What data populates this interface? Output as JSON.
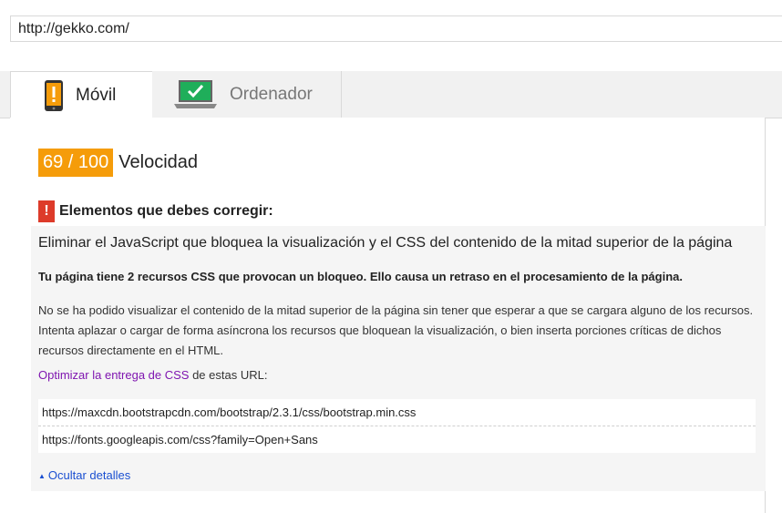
{
  "address_bar": {
    "value": "http://gekko.com/"
  },
  "tabs": [
    {
      "label": "Móvil",
      "icon": "phone-warning-icon",
      "active": true
    },
    {
      "label": "Ordenador",
      "icon": "laptop-check-icon",
      "active": false
    }
  ],
  "score": {
    "value": "69 / 100",
    "label": "Velocidad",
    "color": "#f59c0a"
  },
  "fix_section": {
    "title": "Elementos que debes corregir:",
    "icon_glyph": "!",
    "icon_color": "#dd3b2a"
  },
  "rule": {
    "title": "Eliminar el JavaScript que bloquea la visualización y el CSS del contenido de la mitad superior de la página",
    "summary": "Tu página tiene 2 recursos CSS que provocan un bloqueo. Ello causa un retraso en el procesamiento de la página.",
    "description": "No se ha podido visualizar el contenido de la mitad superior de la página sin tener que esperar a que se cargara alguno de los recursos. Intenta aplazar o cargar de forma asíncrona los recursos que bloquean la visualización, o bien inserta porciones críticas de dichos recursos directamente en el HTML.",
    "link_text": "Optimizar la entrega de CSS",
    "link_suffix": " de estas URL:",
    "urls": [
      "https://maxcdn.bootstrapcdn.com/bootstrap/2.3.1/css/bootstrap.min.css",
      "https://fonts.googleapis.com/css?family=Open+Sans"
    ],
    "toggle_label": "Ocultar detalles"
  }
}
